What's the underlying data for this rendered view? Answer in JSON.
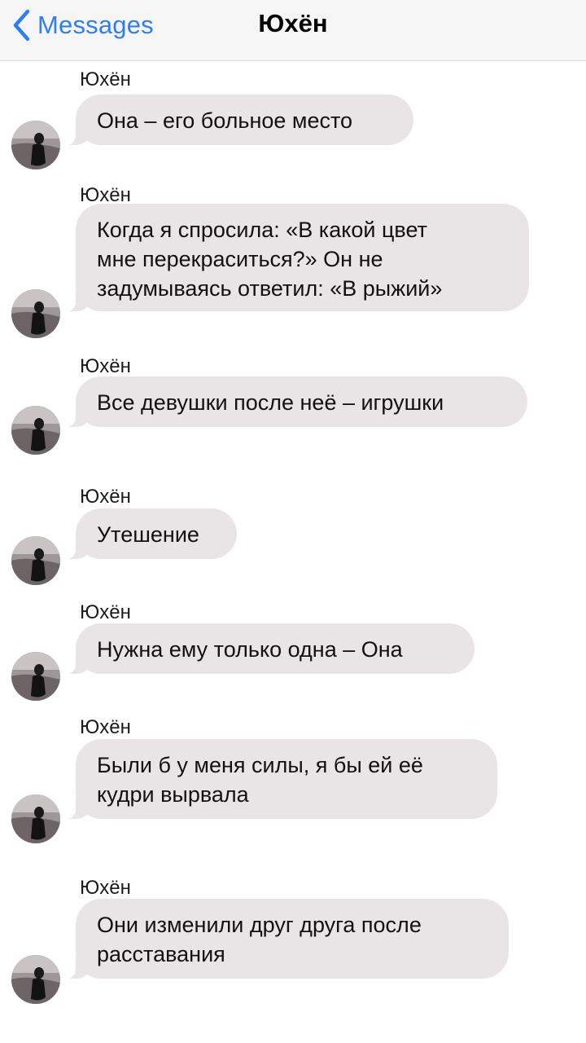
{
  "header": {
    "back_label": "Messages",
    "title": "Юхён"
  },
  "messages": [
    {
      "sender": "Юхён",
      "text": "Она – его больное место"
    },
    {
      "sender": "Юхён",
      "text": "Когда я спросила: «В какой цвет\nмне перекраситься?» Он не\nзадумываясь ответил: «В рыжий»"
    },
    {
      "sender": "Юхён",
      "text": "Все девушки после неё – игрушки"
    },
    {
      "sender": "Юхён",
      "text": "Утешение"
    },
    {
      "sender": "Юхён",
      "text": "Нужна ему только одна – Она"
    },
    {
      "sender": "Юхён",
      "text": "Были б у меня силы, я бы ей её\nкудри вырвала"
    },
    {
      "sender": "Юхён",
      "text": "Они изменили друг друга после\nрасставания"
    }
  ],
  "icons": {
    "back": "chevron-left-icon",
    "avatar": "contact-avatar-photo"
  },
  "colors": {
    "accent": "#2f7df6",
    "bubble": "#e9e5e6",
    "nav_background": "#f7f6f6"
  }
}
